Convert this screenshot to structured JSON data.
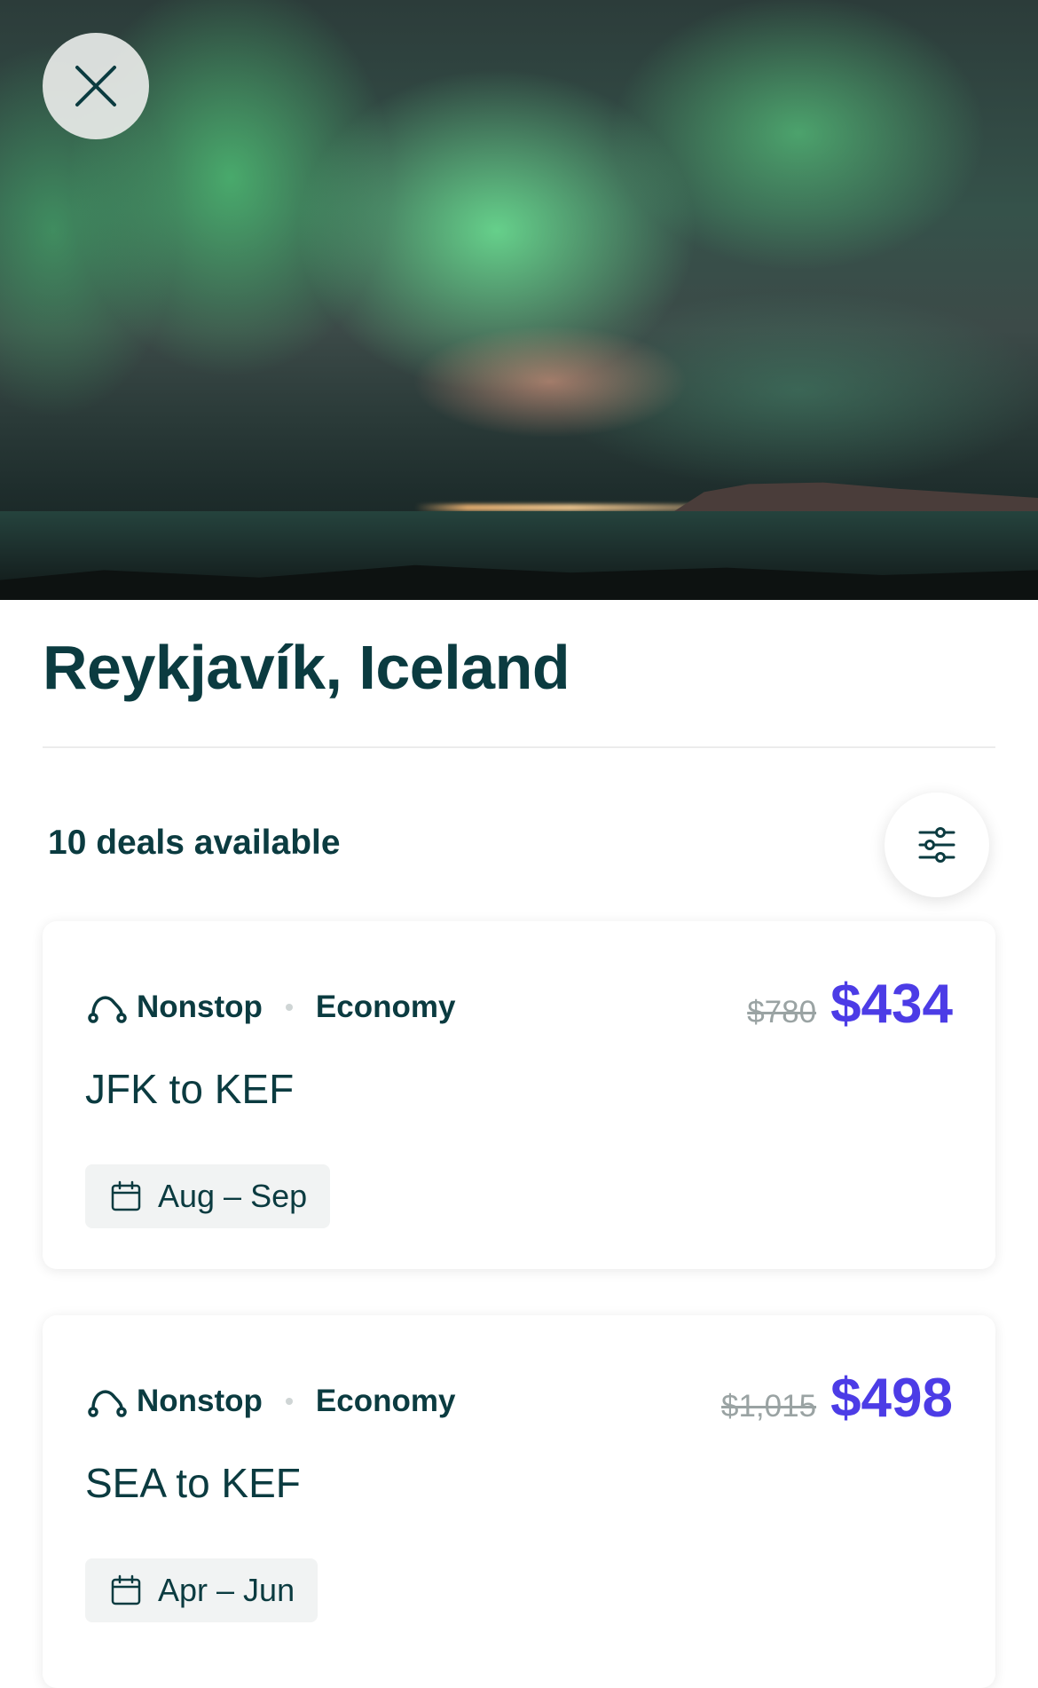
{
  "hero": {
    "image_name": "northern-lights-over-reykjavik",
    "close_icon": "close-icon"
  },
  "destination": {
    "title": "Reykjavík, Iceland"
  },
  "deals": {
    "count_label": "10 deals available",
    "filter_icon": "sliders-icon",
    "items": [
      {
        "stops": "Nonstop",
        "cabin": "Economy",
        "old_price": "$780",
        "price": "$434",
        "route": "JFK to KEF",
        "dates": "Aug – Sep"
      },
      {
        "stops": "Nonstop",
        "cabin": "Economy",
        "old_price": "$1,015",
        "price": "$498",
        "route": "SEA to KEF",
        "dates": "Apr – Jun"
      }
    ]
  },
  "colors": {
    "primary_text": "#0b3b40",
    "price_accent": "#4c3ce6",
    "muted": "#9aa3a3"
  }
}
